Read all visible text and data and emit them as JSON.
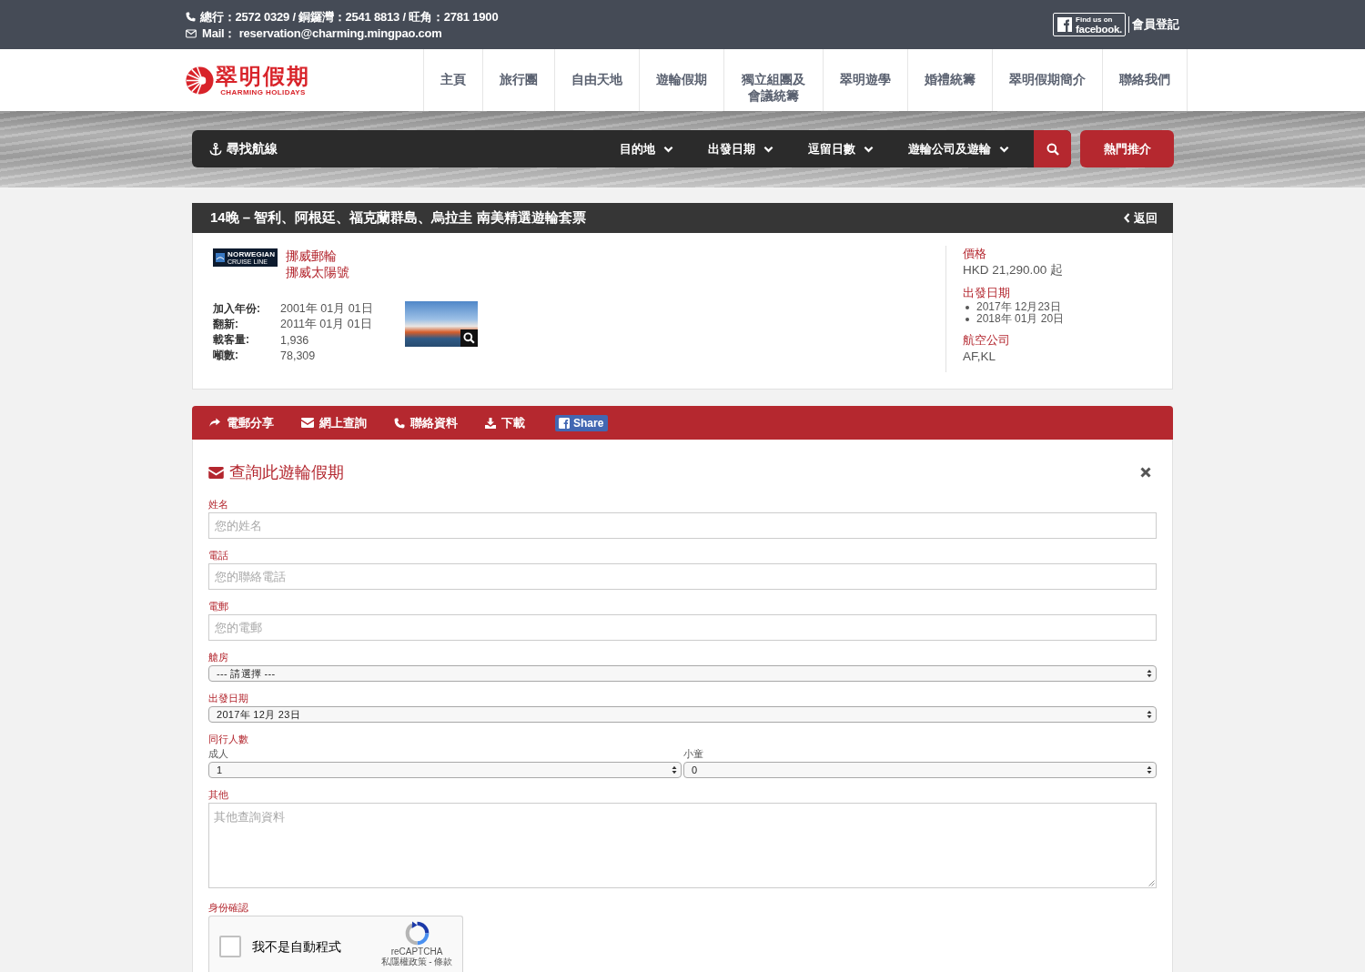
{
  "top_bar": {
    "phones": "總行：2572 0329 / 銅鑼灣：2541 8813 / 旺角：2781 1900",
    "mail": "Mail： reservation@charming.mingpao.com",
    "badge": {
      "line_1": "Find us on",
      "line_2": "facebook."
    },
    "member_link": "會員登記"
  },
  "logo": {
    "name": "翠明假期",
    "tagline": "CHARMING HOLIDAYS"
  },
  "nav": [
    {
      "label": "主頁"
    },
    {
      "label": "旅行團"
    },
    {
      "label": "自由天地"
    },
    {
      "label": "遊輪假期"
    },
    {
      "label": "獨立組團及會議統籌"
    },
    {
      "label": "翠明遊學"
    },
    {
      "label": "婚禮統籌"
    },
    {
      "label": "翠明假期簡介"
    },
    {
      "label": "聯絡我們"
    }
  ],
  "search_bar": {
    "title": "尋找航線",
    "filters": [
      {
        "label": "目的地"
      },
      {
        "label": "出發日期"
      },
      {
        "label": "逗留日數"
      },
      {
        "label": "遊輪公司及遊輪"
      }
    ],
    "hot_button": "熱門推介"
  },
  "detail": {
    "title": "14晚 – 智利、阿根廷、福克蘭群島、烏拉圭 南美精選遊輪套票",
    "back": "返回",
    "cruise_logo": {
      "wordmark": "NORWEGIAN",
      "subtitle": "CRUISE LINE"
    },
    "cruise_line": "挪威郵輪",
    "ship": "挪威太陽號",
    "specs": [
      {
        "label": "加入年份:",
        "value": "2001年 01月 01日"
      },
      {
        "label": "翻新:",
        "value": "2011年 01月 01日"
      },
      {
        "label": "載客量:",
        "value": "1,936"
      },
      {
        "label": "噸數:",
        "value": "78,309"
      }
    ],
    "price_label": "價格",
    "price": "HKD 21,290.00 起",
    "departure_label": "出發日期",
    "departures": [
      "2017年 12月23日",
      "2018年 01月 20日"
    ],
    "airline_label": "航空公司",
    "airline": "AF,KL"
  },
  "actions": [
    {
      "kind": "link",
      "label": "電郵分享"
    },
    {
      "kind": "link",
      "label": "網上查詢"
    },
    {
      "kind": "link",
      "label": "聯絡資料"
    },
    {
      "kind": "link",
      "label": "下載"
    },
    {
      "kind": "facebook",
      "label": "Share"
    }
  ],
  "form": {
    "title": "查詢此遊輪假期",
    "fields": [
      {
        "kind": "text",
        "label": "姓名",
        "placeholder": "您的姓名"
      },
      {
        "kind": "text",
        "label": "電話",
        "placeholder": "您的聯絡電話"
      },
      {
        "kind": "text",
        "label": "電郵",
        "placeholder": "您的電郵"
      },
      {
        "kind": "select",
        "label": "艙房",
        "value": "--- 請選擇 ---"
      },
      {
        "kind": "select",
        "label": "出發日期",
        "value": "2017年 12月 23日"
      },
      {
        "kind": "pair",
        "label": "同行人數",
        "items": [
          {
            "label": "成人",
            "value": "1"
          },
          {
            "label": "小童",
            "value": "0"
          }
        ]
      },
      {
        "kind": "textarea",
        "label": "其他",
        "placeholder": "其他查詢資料"
      },
      {
        "kind": "captcha",
        "label": "身份確認",
        "checkbox_label": "我不是自動程式",
        "checked": false,
        "brand": "reCAPTCHA",
        "links": "私隱權政策 - 條款"
      }
    ]
  }
}
